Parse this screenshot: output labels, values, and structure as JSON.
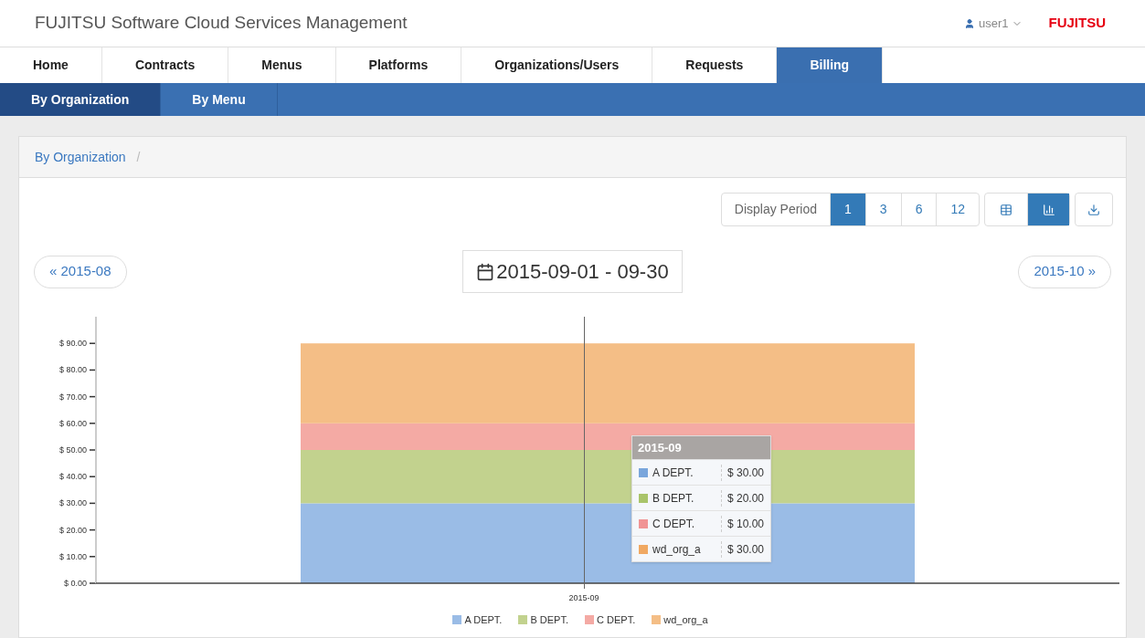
{
  "header": {
    "title": "FUJITSU Software Cloud Services Management",
    "user": "user1",
    "logo": "FUJITSU"
  },
  "tabs": [
    {
      "label": "Home",
      "selected": false
    },
    {
      "label": "Contracts",
      "selected": false
    },
    {
      "label": "Menus",
      "selected": false
    },
    {
      "label": "Platforms",
      "selected": false
    },
    {
      "label": "Organizations/Users",
      "selected": false
    },
    {
      "label": "Requests",
      "selected": false
    },
    {
      "label": "Billing",
      "selected": true
    }
  ],
  "subtabs": [
    {
      "label": "By Organization",
      "selected": true
    },
    {
      "label": "By Menu",
      "selected": false
    }
  ],
  "breadcrumb": [
    "By Organization"
  ],
  "breadcrumb_separator": "/",
  "display_period": {
    "label": "Display Period",
    "options": [
      {
        "label": "1",
        "selected": true
      },
      {
        "label": "3",
        "selected": false
      },
      {
        "label": "6",
        "selected": false
      },
      {
        "label": "12",
        "selected": false
      }
    ]
  },
  "view_buttons": [
    {
      "kind": "table",
      "selected": false
    },
    {
      "kind": "chart",
      "selected": true
    }
  ],
  "prev_button": "« 2015-08",
  "date_range": "2015-09-01 - 09-30",
  "next_button": "2015-10 »",
  "chart": {
    "chart_data": {
      "type": "bar",
      "stacked": true,
      "categories": [
        "2015-09"
      ],
      "ylim": [
        0,
        100
      ],
      "legend": true,
      "yticks": [
        {
          "value": 0,
          "label": "$ 0.00"
        },
        {
          "value": 10,
          "label": "$ 10.00"
        },
        {
          "value": 20,
          "label": "$ 20.00"
        },
        {
          "value": 30,
          "label": "$ 30.00"
        },
        {
          "value": 40,
          "label": "$ 40.00"
        },
        {
          "value": 50,
          "label": "$ 50.00"
        },
        {
          "value": 60,
          "label": "$ 60.00"
        },
        {
          "value": 70,
          "label": "$ 70.00"
        },
        {
          "value": 80,
          "label": "$ 80.00"
        },
        {
          "value": 90,
          "label": "$ 90.00"
        }
      ],
      "series": [
        {
          "name": "A DEPT.",
          "color": "#9abce6",
          "values": [
            30
          ]
        },
        {
          "name": "B DEPT.",
          "color": "#c2d28e",
          "values": [
            20
          ]
        },
        {
          "name": "C DEPT.",
          "color": "#f4aaa4",
          "values": [
            10
          ]
        },
        {
          "name": "wd_org_a",
          "color": "#f4be86",
          "values": [
            30
          ]
        }
      ]
    },
    "tooltip": {
      "title": "2015-09",
      "rows": [
        {
          "name": "A DEPT.",
          "value": "$ 30.00",
          "color": "#7aa6dc"
        },
        {
          "name": "B DEPT.",
          "value": "$ 20.00",
          "color": "#a9c46a"
        },
        {
          "name": "C DEPT.",
          "value": "$ 10.00",
          "color": "#f09494"
        },
        {
          "name": "wd_org_a",
          "value": "$ 30.00",
          "color": "#f0a862"
        }
      ]
    }
  }
}
